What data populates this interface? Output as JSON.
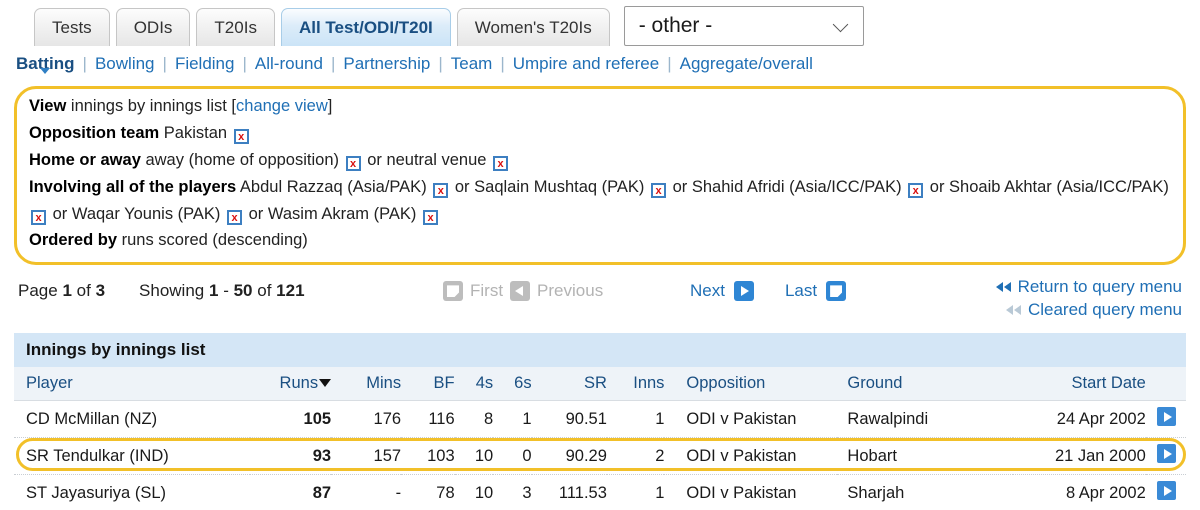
{
  "tabs": {
    "items": [
      {
        "label": "Tests",
        "active": false
      },
      {
        "label": "ODIs",
        "active": false
      },
      {
        "label": "T20Is",
        "active": false
      },
      {
        "label": "All Test/ODI/T20I",
        "active": true
      },
      {
        "label": "Women's T20Is",
        "active": false
      }
    ],
    "select_value": "- other -",
    "select_icon": "chevron-down-icon"
  },
  "nav": {
    "items": [
      {
        "label": "Batting",
        "active": true
      },
      {
        "label": "Bowling",
        "active": false
      },
      {
        "label": "Fielding",
        "active": false
      },
      {
        "label": "All-round",
        "active": false
      },
      {
        "label": "Partnership",
        "active": false
      },
      {
        "label": "Team",
        "active": false
      },
      {
        "label": "Umpire and referee",
        "active": false
      },
      {
        "label": "Aggregate/overall",
        "active": false
      }
    ],
    "separator": "|"
  },
  "query": {
    "view_label": "View",
    "view_value": "innings by innings list",
    "change_view_open": "[",
    "change_view_link": "change view",
    "change_view_close": "]",
    "opposition_label": "Opposition team",
    "opposition_value": "Pakistan",
    "homeaway_label": "Home or away",
    "homeaway_value": "away (home of opposition)",
    "homeaway_or": "or neutral venue",
    "players_label": "Involving all of the players",
    "players": [
      "Abdul Razzaq (Asia/PAK)",
      "Saqlain Mushtaq (PAK)",
      "Shahid Afridi (Asia/ICC/PAK)",
      "Shoaib Akhtar (Asia/ICC/PAK)",
      "Waqar Younis (PAK)",
      "Wasim Akram (PAK)"
    ],
    "player_joiner": "or",
    "ordered_label": "Ordered by",
    "ordered_value": "runs scored (descending)",
    "remove_icon": "remove-x-icon",
    "remove_glyph": "x",
    "border_color": "#f2c029"
  },
  "pager": {
    "page_word": "Page",
    "page_current": "1",
    "page_of": "of",
    "page_total": "3",
    "showing_word": "Showing",
    "showing_from": "1",
    "showing_dash": "-",
    "showing_to": "50",
    "showing_of": "of",
    "showing_total": "121",
    "first_label": "First",
    "previous_label": "Previous",
    "next_label": "Next",
    "last_label": "Last",
    "first_icon": "first-page-icon",
    "previous_icon": "previous-arrow-icon",
    "next_icon": "next-arrow-icon",
    "last_icon": "last-page-icon",
    "return_menu_label": "Return to query menu",
    "cleared_menu_label": "Cleared query menu",
    "return_menu_icon": "double-left-arrow-icon",
    "cleared_menu_icon": "double-left-arrow-faint-icon"
  },
  "table": {
    "title": "Innings by innings list",
    "columns": [
      "Player",
      "Runs",
      "Mins",
      "BF",
      "4s",
      "6s",
      "SR",
      "Inns",
      "Opposition",
      "Ground",
      "Start Date",
      ""
    ],
    "sorted_column": "Runs",
    "sort_direction": "descending",
    "sort_icon": "sort-descending-caret-icon",
    "row_action_icon": "go-arrow-icon",
    "rows": [
      {
        "player": "CD McMillan (NZ)",
        "runs": "105",
        "mins": "176",
        "bf": "116",
        "fours": "8",
        "sixes": "1",
        "sr": "90.51",
        "inns": "1",
        "opposition": "ODI v Pakistan",
        "ground": "Rawalpindi",
        "start_date": "24 Apr 2002",
        "highlighted": false
      },
      {
        "player": "SR Tendulkar (IND)",
        "runs": "93",
        "mins": "157",
        "bf": "103",
        "fours": "10",
        "sixes": "0",
        "sr": "90.29",
        "inns": "2",
        "opposition": "ODI v Pakistan",
        "ground": "Hobart",
        "start_date": "21 Jan 2000",
        "highlighted": true
      },
      {
        "player": "ST Jayasuriya (SL)",
        "runs": "87",
        "mins": "-",
        "bf": "78",
        "fours": "10",
        "sixes": "3",
        "sr": "111.53",
        "inns": "1",
        "opposition": "ODI v Pakistan",
        "ground": "Sharjah",
        "start_date": "8 Apr 2002",
        "highlighted": false
      }
    ]
  },
  "colors": {
    "accent_blue": "#1f6fb5",
    "highlight_yellow": "#f2c029",
    "table_title_bg": "#d4e6f6",
    "table_header_bg": "#eef3f8",
    "button_blue": "#3a8ad6"
  }
}
